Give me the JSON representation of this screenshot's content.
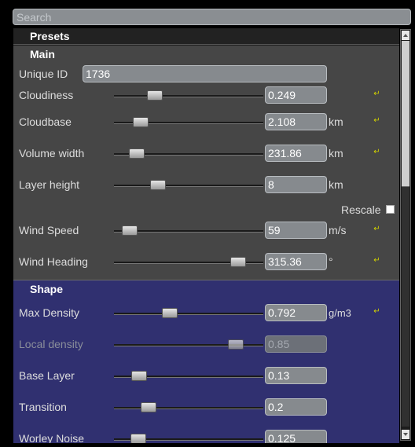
{
  "search": {
    "placeholder": "Search"
  },
  "presets": {
    "title": "Presets"
  },
  "main": {
    "title": "Main",
    "unique_id": {
      "label": "Unique ID",
      "value": "1736"
    },
    "rows": [
      {
        "label": "Cloudiness",
        "value": "0.249",
        "unit": "",
        "slider": 0.249,
        "reset": true
      },
      {
        "label": "Cloudbase",
        "value": "2.108",
        "unit": "km",
        "slider": 0.14,
        "reset": true
      },
      {
        "label": "Volume width",
        "value": "231.86",
        "unit": "km",
        "slider": 0.11,
        "reset": true
      },
      {
        "label": "Layer height",
        "value": "8",
        "unit": "km",
        "slider": 0.27,
        "reset": false
      },
      {
        "label": "Wind Speed",
        "value": "59",
        "unit": "m/s",
        "slider": 0.06,
        "reset": true
      },
      {
        "label": "Wind Heading",
        "value": "315.36",
        "unit": "°",
        "slider": 0.87,
        "reset": true
      }
    ],
    "rescale_label": "Rescale",
    "rescale_checked": false
  },
  "shape": {
    "title": "Shape",
    "rows": [
      {
        "label": "Max Density",
        "value": "0.792",
        "unit": "g/m3",
        "slider": 0.36,
        "reset": true,
        "disabled": false
      },
      {
        "label": "Local density",
        "value": "0.85",
        "unit": "",
        "slider": 0.85,
        "reset": false,
        "disabled": true
      },
      {
        "label": "Base Layer",
        "value": "0.13",
        "unit": "",
        "slider": 0.13,
        "reset": false,
        "disabled": false
      },
      {
        "label": "Transition",
        "value": "0.2",
        "unit": "",
        "slider": 0.2,
        "reset": false,
        "disabled": false
      },
      {
        "label": "Worley Noise",
        "value": "0.125",
        "unit": "",
        "slider": 0.125,
        "reset": false,
        "disabled": false
      }
    ]
  },
  "reset_icon": "undo-arrow-icon",
  "colors": {
    "main_bg": "#464646",
    "shape_bg": "#303070",
    "field_bg": "#868a8e",
    "reset_icon": "#d0d000"
  }
}
